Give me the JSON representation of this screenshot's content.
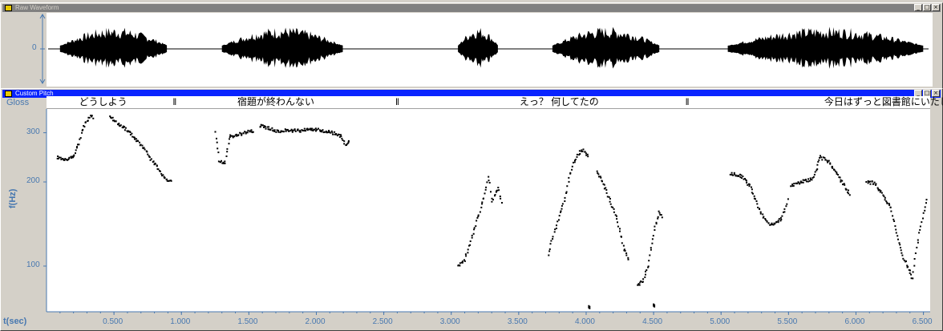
{
  "windows": {
    "raw": {
      "title": "Raw Waveform"
    },
    "pitch": {
      "title": "Custom Pitch"
    }
  },
  "title_buttons": {
    "minimize": "_",
    "restore": "□",
    "close": "×"
  },
  "gloss": {
    "label": "Gloss",
    "items": [
      {
        "text": "どうしよう",
        "t": 0.42
      },
      {
        "text": "‖",
        "t": 0.95
      },
      {
        "text": "宿題が終わんない",
        "t": 1.7
      },
      {
        "text": "‖",
        "t": 2.6
      },
      {
        "text": "えっ？ 何してたの",
        "t": 3.8
      },
      {
        "text": "‖",
        "t": 4.75
      },
      {
        "text": "今日はずっと図書館にいたじゃん",
        "t": 6.3
      }
    ]
  },
  "axes": {
    "y_label": "f(Hz)",
    "t_label": "t(sec)",
    "waveform_zero": "0",
    "y_ticks": [
      {
        "label": "300",
        "v": 300
      },
      {
        "label": "200",
        "v": 200
      },
      {
        "label": "100",
        "v": 100
      }
    ],
    "x_ticks": [
      {
        "label": "0.500",
        "t": 0.5
      },
      {
        "label": "1.000",
        "t": 1.0
      },
      {
        "label": "1.500",
        "t": 1.5
      },
      {
        "label": "2.000",
        "t": 2.0
      },
      {
        "label": "2.500",
        "t": 2.5
      },
      {
        "label": "3.000",
        "t": 3.0
      },
      {
        "label": "3.500",
        "t": 3.5
      },
      {
        "label": "4.000",
        "t": 4.0
      },
      {
        "label": "4.500",
        "t": 4.5
      },
      {
        "label": "5.000",
        "t": 5.0
      },
      {
        "label": "5.500",
        "t": 5.5
      },
      {
        "label": "6.000",
        "t": 6.0
      },
      {
        "label": "6.500",
        "t": 6.5
      }
    ],
    "x_range": [
      0.0,
      6.55
    ],
    "y_range": [
      70,
      360
    ],
    "y_scale": "log"
  },
  "chart_data": {
    "type": "scatter",
    "xlabel": "t(sec)",
    "ylabel": "f(Hz)",
    "xlim": [
      0.0,
      6.55
    ],
    "ylim": [
      70,
      360
    ],
    "y_scale": "log",
    "grid": false,
    "waveform_segments": [
      [
        0.1,
        0.9
      ],
      [
        1.3,
        2.2
      ],
      [
        3.05,
        3.35
      ],
      [
        3.75,
        4.55
      ],
      [
        5.05,
        6.5
      ]
    ],
    "pitch_contours": [
      [
        [
          0.08,
          245
        ],
        [
          0.12,
          242
        ],
        [
          0.16,
          240
        ],
        [
          0.2,
          248
        ],
        [
          0.24,
          275
        ],
        [
          0.27,
          310
        ],
        [
          0.3,
          330
        ],
        [
          0.33,
          345
        ],
        [
          0.35,
          335
        ]
      ],
      [
        [
          0.47,
          345
        ],
        [
          0.5,
          330
        ],
        [
          0.55,
          320
        ],
        [
          0.62,
          300
        ],
        [
          0.7,
          270
        ],
        [
          0.78,
          240
        ],
        [
          0.85,
          215
        ],
        [
          0.9,
          200
        ],
        [
          0.93,
          205
        ]
      ],
      [
        [
          1.25,
          300
        ],
        [
          1.28,
          240
        ],
        [
          1.32,
          230
        ],
        [
          1.36,
          290
        ],
        [
          1.42,
          295
        ],
        [
          1.48,
          300
        ],
        [
          1.54,
          305
        ]
      ],
      [
        [
          1.58,
          318
        ],
        [
          1.7,
          305
        ],
        [
          1.85,
          305
        ],
        [
          2.0,
          308
        ],
        [
          2.1,
          302
        ],
        [
          2.18,
          292
        ],
        [
          2.22,
          270
        ],
        [
          2.25,
          280
        ]
      ],
      [
        [
          3.05,
          100
        ],
        [
          3.1,
          105
        ],
        [
          3.15,
          125
        ],
        [
          3.2,
          150
        ],
        [
          3.25,
          180
        ],
        [
          3.28,
          210
        ],
        [
          3.3,
          170
        ],
        [
          3.35,
          190
        ],
        [
          3.38,
          165
        ]
      ],
      [
        [
          3.72,
          110
        ],
        [
          3.8,
          150
        ],
        [
          3.85,
          180
        ],
        [
          3.9,
          230
        ],
        [
          3.95,
          255
        ],
        [
          3.98,
          260
        ],
        [
          4.02,
          245
        ]
      ],
      [
        [
          4.08,
          220
        ],
        [
          4.12,
          200
        ],
        [
          4.18,
          170
        ],
        [
          4.24,
          140
        ],
        [
          4.28,
          115
        ],
        [
          4.32,
          105
        ]
      ],
      [
        [
          4.38,
          85
        ],
        [
          4.42,
          88
        ],
        [
          4.46,
          100
        ],
        [
          4.5,
          130
        ],
        [
          4.54,
          155
        ],
        [
          4.57,
          148
        ]
      ],
      [
        [
          5.07,
          215
        ],
        [
          5.15,
          210
        ],
        [
          5.22,
          190
        ],
        [
          5.28,
          160
        ],
        [
          5.33,
          145
        ],
        [
          5.38,
          140
        ],
        [
          5.45,
          148
        ],
        [
          5.5,
          175
        ]
      ],
      [
        [
          5.52,
          195
        ],
        [
          5.6,
          200
        ],
        [
          5.68,
          205
        ],
        [
          5.74,
          245
        ],
        [
          5.8,
          235
        ],
        [
          5.86,
          215
        ],
        [
          5.92,
          190
        ],
        [
          5.96,
          180
        ]
      ],
      [
        [
          6.08,
          200
        ],
        [
          6.14,
          198
        ],
        [
          6.2,
          180
        ],
        [
          6.26,
          160
        ],
        [
          6.3,
          130
        ],
        [
          6.34,
          110
        ],
        [
          6.38,
          100
        ],
        [
          6.42,
          90
        ],
        [
          6.5,
          155
        ],
        [
          6.53,
          175
        ]
      ]
    ],
    "outliers": [
      [
        4.02,
        72
      ],
      [
        4.5,
        73
      ]
    ]
  }
}
